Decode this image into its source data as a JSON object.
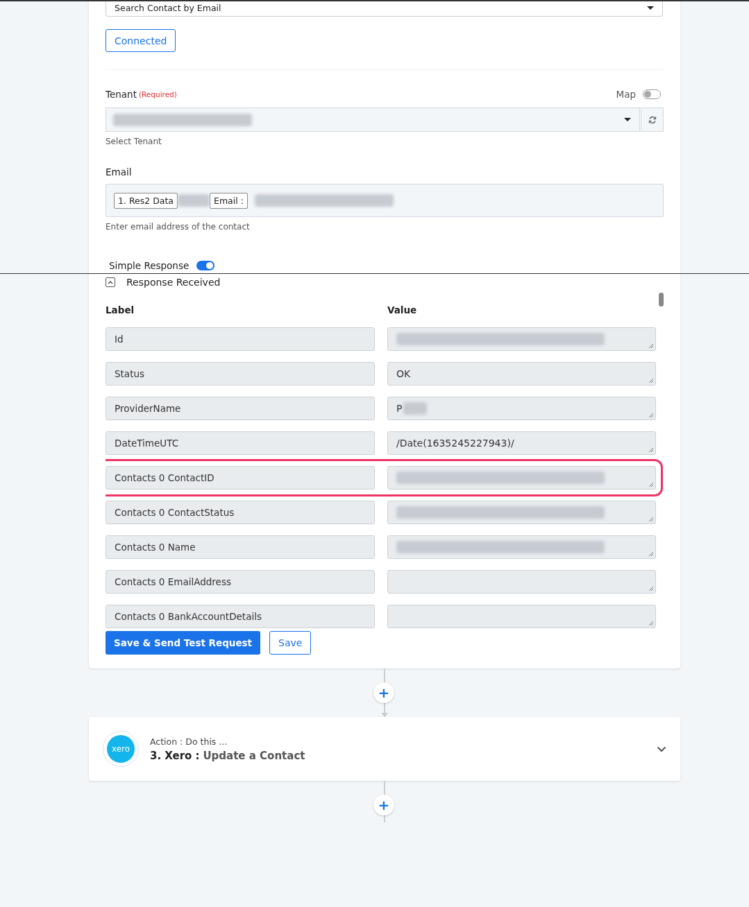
{
  "action_select": {
    "value": "Search Contact by Email"
  },
  "connection_button": "Connected",
  "tenant": {
    "label": "Tenant",
    "required": "(Required)",
    "map_label": "Map",
    "map_on": false,
    "value_redacted": true,
    "hint": "Select Tenant"
  },
  "email": {
    "label": "Email",
    "tokens": [
      {
        "kind": "chip",
        "text": "1. Res2 Data"
      },
      {
        "kind": "redacted"
      },
      {
        "kind": "chip",
        "text": "Email :"
      },
      {
        "kind": "redacted"
      }
    ],
    "hint": "Enter email address of the contact"
  },
  "simple_response": {
    "label": "Simple Response",
    "on": true
  },
  "response": {
    "title": "Response Received",
    "expanded": true,
    "label_heading": "Label",
    "value_heading": "Value",
    "rows": [
      {
        "label": "Id",
        "redacted": true,
        "highlighted": false
      },
      {
        "label": "Status",
        "value": "OK",
        "redacted": false,
        "highlighted": false
      },
      {
        "label": "ProviderName",
        "value": "P",
        "redacted": true,
        "highlighted": false
      },
      {
        "label": "DateTimeUTC",
        "value": "/Date(1635245227943)/",
        "redacted": false,
        "highlighted": false
      },
      {
        "label": "Contacts 0 ContactID",
        "redacted": true,
        "highlighted": true
      },
      {
        "label": "Contacts 0 ContactStatus",
        "redacted": true,
        "highlighted": false
      },
      {
        "label": "Contacts 0 Name",
        "redacted": true,
        "highlighted": false
      },
      {
        "label": "Contacts 0 EmailAddress",
        "redacted": false,
        "highlighted": false
      },
      {
        "label": "Contacts 0 BankAccountDetails",
        "redacted": false,
        "highlighted": false
      }
    ]
  },
  "buttons": {
    "primary": "Save & Send Test Request",
    "secondary": "Save"
  },
  "add_step_buttons": [
    "+",
    "+"
  ],
  "next_step": {
    "logo": "xero",
    "subtitle": "Action : Do this ...",
    "app": "3. Xero :",
    "action": "Update a Contact"
  }
}
